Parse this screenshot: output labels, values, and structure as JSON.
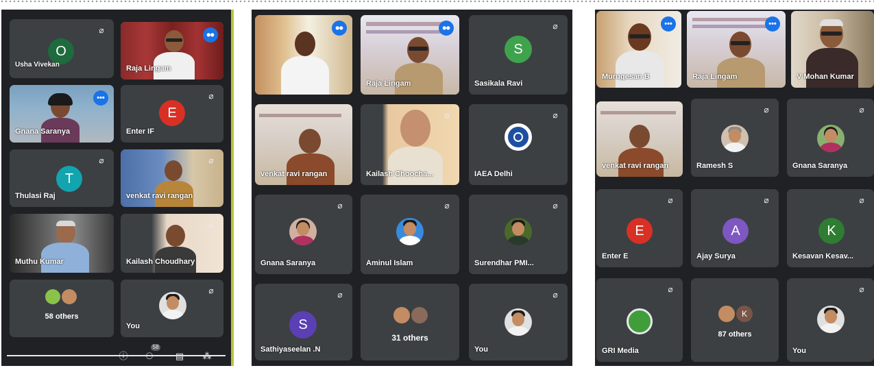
{
  "panel1": {
    "tiles": [
      {
        "name": "Usha Vivekan",
        "initial": "O",
        "avatar_color": "#1e6b3e",
        "muted": true
      },
      {
        "name": "Raja Lingam",
        "speaking": true
      },
      {
        "name": "Gnana Saranya",
        "speaking": true
      },
      {
        "name": "Enter IF",
        "initial": "E",
        "avatar_color": "#d93025",
        "muted": true
      },
      {
        "name": "Thulasi Raj",
        "initial": "T",
        "avatar_color": "#12a4af",
        "muted": true
      },
      {
        "name": "venkat ravi rangan",
        "muted": true
      },
      {
        "name": "Muthu Kumar"
      },
      {
        "name": "Kailash Choudhary",
        "muted": true
      },
      {
        "name": "58 others"
      },
      {
        "name": "You",
        "muted": true
      }
    ],
    "controls": [
      "info-icon",
      "people-icon",
      "chat-icon",
      "activities-icon"
    ],
    "participant_badge": "58"
  },
  "panel2": {
    "tiles": [
      {
        "name": "",
        "speaking": true
      },
      {
        "name": "Raja Lingam",
        "speaking": true
      },
      {
        "name": "Sasikala Ravi",
        "initial": "S",
        "avatar_color": "#3fa34d",
        "muted": true
      },
      {
        "name": "venkat ravi rangan"
      },
      {
        "name": "Kailash Choocha...",
        "muted": true
      },
      {
        "name": "IAEA Delhi",
        "muted": true
      },
      {
        "name": "Gnana Saranya",
        "muted": true
      },
      {
        "name": "Aminul Islam",
        "muted": true
      },
      {
        "name": "Surendhar PMI...",
        "muted": true
      },
      {
        "name": "Sathiyaseelan .N",
        "initial": "S",
        "avatar_color": "#5b3fb5",
        "muted": true
      },
      {
        "name": "31 others"
      },
      {
        "name": "You",
        "muted": true
      }
    ]
  },
  "panel3": {
    "tiles": [
      {
        "name": "Murugesan B",
        "speaking": true
      },
      {
        "name": "Raja Lingam",
        "speaking": true
      },
      {
        "name": "V Mohan Kumar"
      },
      {
        "name": "venkat ravi rangan"
      },
      {
        "name": "Ramesh S",
        "muted": true
      },
      {
        "name": "Gnana Saranya",
        "muted": true
      },
      {
        "name": "Enter E",
        "initial": "E",
        "avatar_color": "#d93025",
        "muted": true
      },
      {
        "name": "Ajay Surya",
        "initial": "A",
        "avatar_color": "#7e57c2",
        "muted": true
      },
      {
        "name": "Kesavan Kesav...",
        "initial": "K",
        "avatar_color": "#2e7d32",
        "muted": true
      },
      {
        "name": "GRI Media",
        "muted": true
      },
      {
        "name": "87 others",
        "initial": "K",
        "avatar_color": "#795548"
      },
      {
        "name": "You",
        "muted": true
      }
    ]
  },
  "colors": {
    "tile": "#3c4043",
    "background": "#202124",
    "active_outline": "#8ab4f8",
    "speaking": "#1a73e8"
  }
}
